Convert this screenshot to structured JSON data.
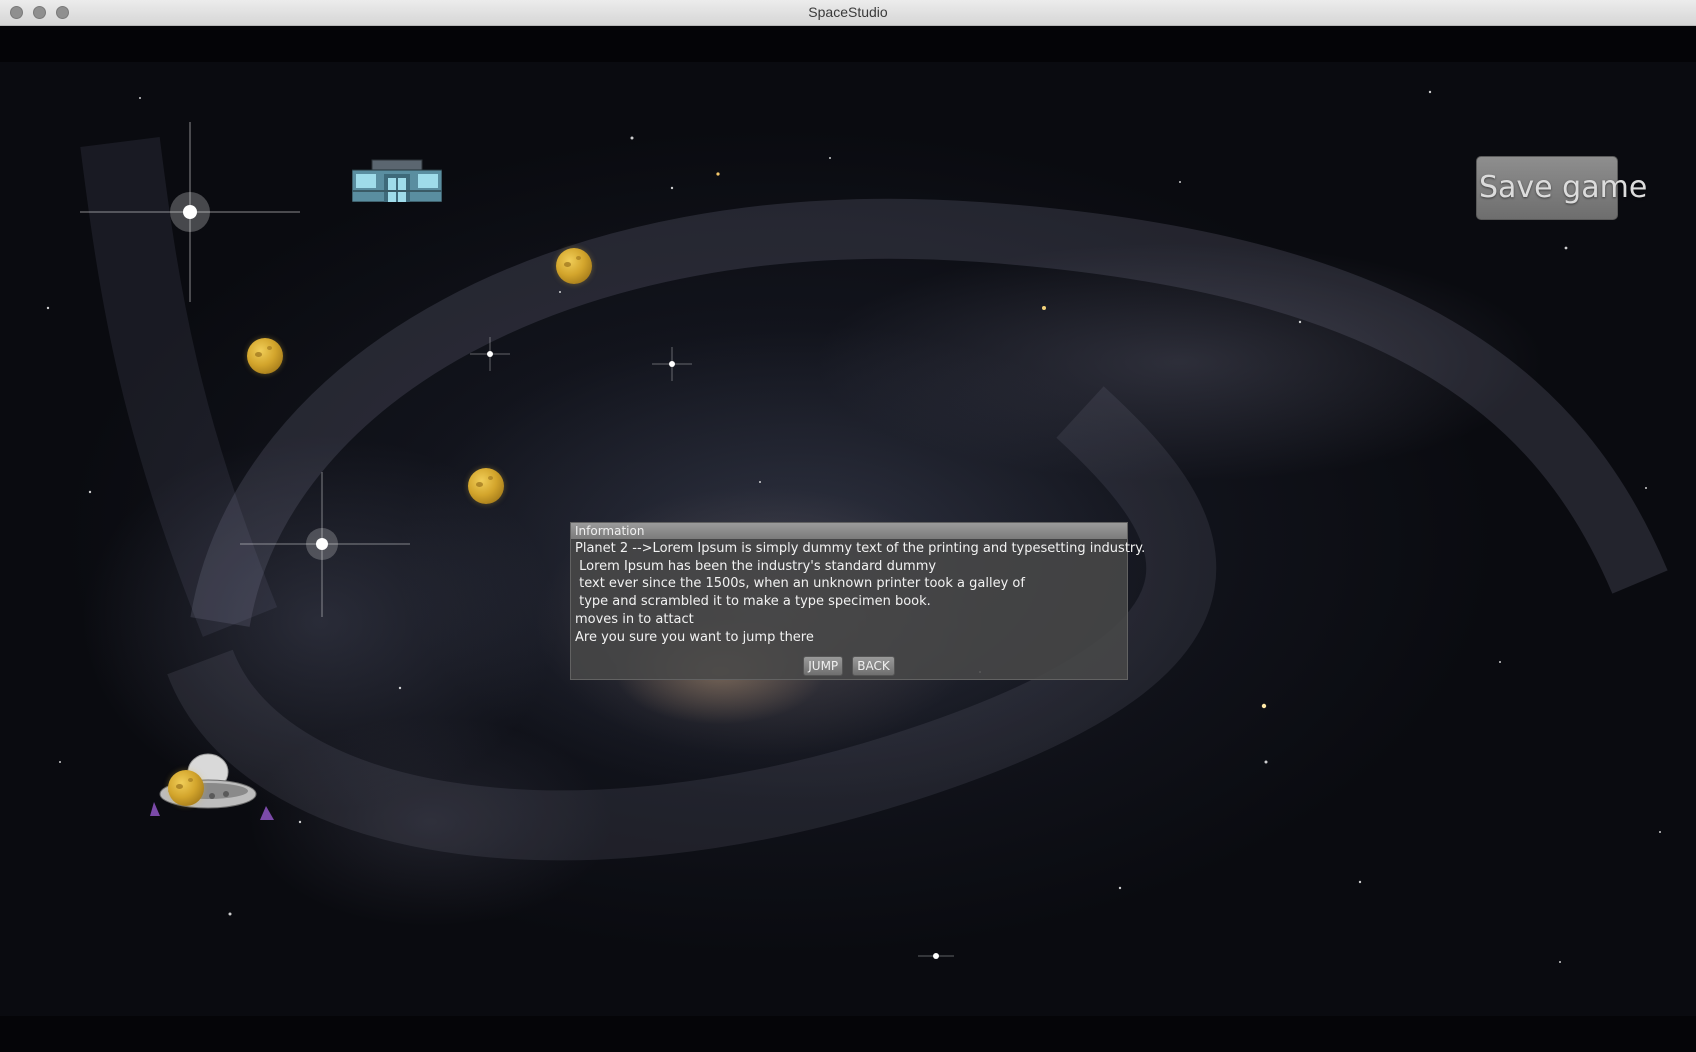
{
  "window": {
    "title": "SpaceStudio"
  },
  "game": {
    "save_button_label": "Save game",
    "dialog": {
      "header": "Information",
      "lines": [
        "Planet 2 -->Lorem Ipsum is simply dummy text of the printing and typesetting industry.",
        " Lorem Ipsum has been the industry's standard dummy",
        " text ever since the 1500s, when an unknown printer took a galley of",
        " type and scrambled it to make a type specimen book.",
        "moves in to attact",
        "Are you sure you want to jump there"
      ],
      "jump_label": "JUMP",
      "back_label": "BACK"
    }
  },
  "colors": {
    "planet": "#d3a52c",
    "dialog_background": "#484848",
    "button_gray": "#7a7a7a"
  },
  "icons": {
    "station": "space-station-icon",
    "ship": "ufo-ship-icon",
    "planet": "planet-icon"
  }
}
